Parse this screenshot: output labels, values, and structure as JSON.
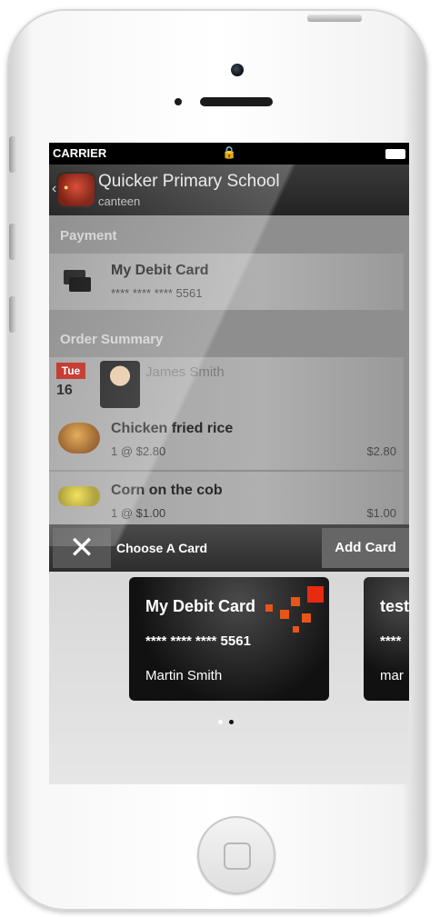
{
  "status_bar": {
    "carrier": "CARRIER",
    "lock_icon": "lock-icon",
    "battery_icon": "battery-icon"
  },
  "header": {
    "title": "Quicker Primary School",
    "subtitle": "canteen",
    "back_icon": "chevron-left-icon",
    "logo_icon": "school-logo-icon"
  },
  "payment": {
    "section_label": "Payment",
    "card_name": "My Debit Card",
    "card_number": "**** **** **** 5561",
    "icon": "credit-cards-icon"
  },
  "order_summary": {
    "section_label": "Order Summary",
    "student": {
      "day": "Tue",
      "date": "16",
      "name": "James Smith"
    },
    "items": [
      {
        "name": "Chicken fried rice",
        "qty_price": "1 @ $2.80",
        "total": "$2.80"
      },
      {
        "name": "Corn on the cob",
        "qty_price": "1 @ $1.00",
        "total": "$1.00"
      }
    ]
  },
  "action_bar": {
    "close_icon": "close-icon",
    "title": "Choose A Card",
    "add_card_label": "Add Card"
  },
  "card_picker": {
    "cards": [
      {
        "name": "My Debit Card",
        "number": "**** **** **** 5561",
        "holder": "Martin Smith"
      },
      {
        "name": "test",
        "number": "****",
        "holder": "mar"
      }
    ],
    "page_count": 2,
    "active_page": 2
  },
  "colors": {
    "accent": "#e8551a",
    "date_badge": "#c0281d",
    "navbar": "#2b2b2b"
  }
}
